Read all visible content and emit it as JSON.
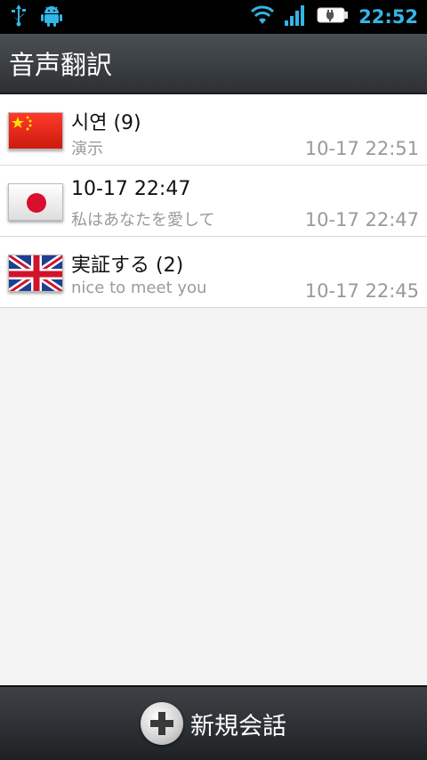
{
  "status_bar": {
    "time": "22:52",
    "icons": [
      "usb-icon",
      "android-debug-icon",
      "wifi-icon",
      "signal-icon",
      "battery-charging-icon"
    ]
  },
  "app": {
    "title": "音声翻訳"
  },
  "conversations": [
    {
      "flag": "china-flag-icon",
      "title": "시연 (9)",
      "subtitle": "演示",
      "time": "10-17 22:51"
    },
    {
      "flag": "japan-flag-icon",
      "title": "10-17 22:47",
      "subtitle": "私はあなたを愛して",
      "time": "10-17 22:47"
    },
    {
      "flag": "uk-flag-icon",
      "title": "実証する (2)",
      "subtitle": "nice to meet you",
      "time": "10-17 22:45"
    }
  ],
  "bottom_bar": {
    "new_conversation_label": "新規会話",
    "icon": "plus-icon"
  },
  "colors": {
    "status_time": "#33b5e5",
    "title_bar": "#3b4044",
    "list_bg": "#f3f3f3"
  }
}
